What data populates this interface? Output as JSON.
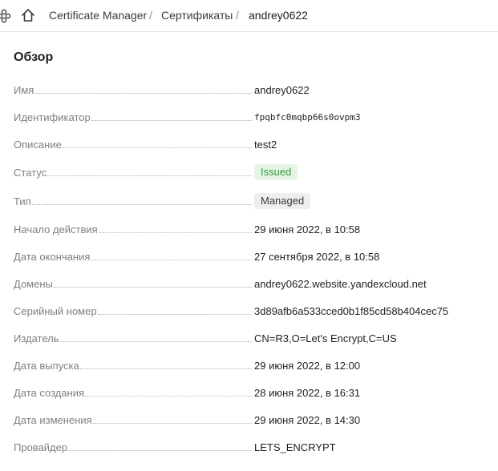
{
  "breadcrumb": {
    "items": [
      "Certificate Manager",
      "Сертификаты",
      "andrey0622"
    ],
    "separator": "/"
  },
  "overview": {
    "title": "Обзор",
    "rows": [
      {
        "label": "Имя",
        "value": "andrey0622"
      },
      {
        "label": "Идентификатор",
        "value": "fpqbfc0mqbp66s0ovpm3"
      },
      {
        "label": "Описание",
        "value": "test2"
      },
      {
        "label": "Статус",
        "value": "Issued"
      },
      {
        "label": "Тип",
        "value": "Managed"
      },
      {
        "label": "Начало действия",
        "value": "29 июня 2022, в 10:58"
      },
      {
        "label": "Дата окончания",
        "value": "27 сентября 2022, в 10:58"
      },
      {
        "label": "Домены",
        "value": "andrey0622.website.yandexcloud.net"
      },
      {
        "label": "Серийный номер",
        "value": "3d89afb6a533cced0b1f85cd58b404cec75"
      },
      {
        "label": "Издатель",
        "value": "CN=R3,O=Let's Encrypt,C=US"
      },
      {
        "label": "Дата выпуска",
        "value": "29 июня 2022, в 12:00"
      },
      {
        "label": "Дата создания",
        "value": "28 июня 2022, в 16:31"
      },
      {
        "label": "Дата изменения",
        "value": "29 июня 2022, в 14:30"
      },
      {
        "label": "Провайдер",
        "value": "LETS_ENCRYPT"
      }
    ]
  },
  "colors": {
    "status_issued_bg": "#e6f4e6",
    "status_issued_text": "#2e9a3a",
    "type_badge_bg": "#eeeeee"
  },
  "icons": [
    "services-icon",
    "home-icon"
  ]
}
